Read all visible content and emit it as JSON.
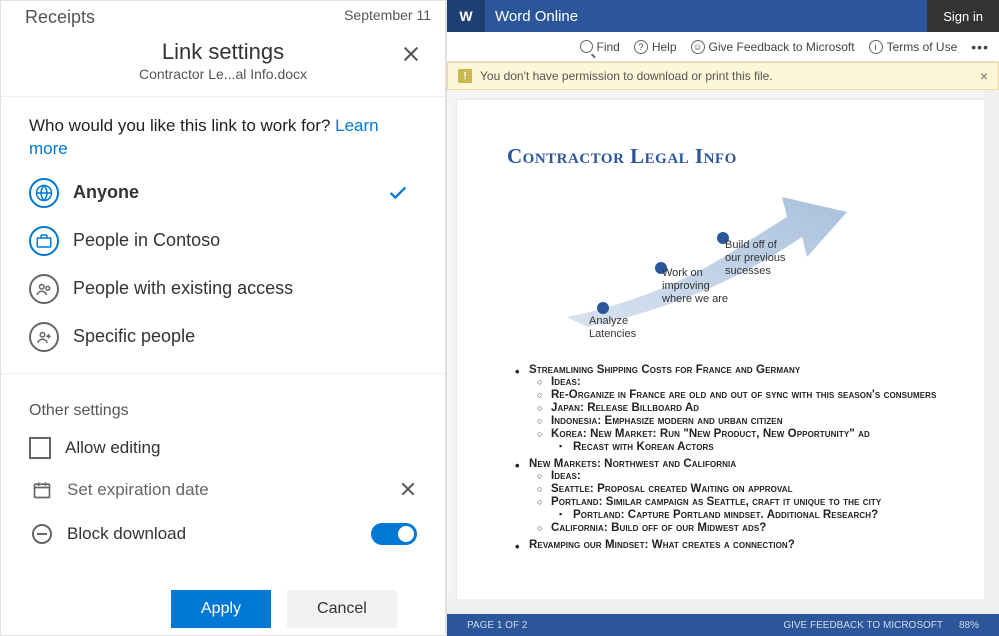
{
  "bg": {
    "text": "Receipts",
    "date": "September 11"
  },
  "dialog": {
    "title": "Link settings",
    "filename": "Contractor Le...al Info.docx",
    "prompt": "Who would you like this link to work for? ",
    "learn_more": "Learn more",
    "options": [
      {
        "label": "Anyone",
        "selected": true
      },
      {
        "label": "People in Contoso",
        "selected": false
      },
      {
        "label": "People with existing access",
        "selected": false
      },
      {
        "label": "Specific people",
        "selected": false
      }
    ],
    "other_title": "Other settings",
    "allow_editing": "Allow editing",
    "expiration": "Set expiration date",
    "block_download": "Block download",
    "apply": "Apply",
    "cancel": "Cancel"
  },
  "word": {
    "app_name": "Word Online",
    "logo_letter": "W",
    "signin": "Sign in",
    "find": "Find",
    "help": "Help",
    "feedback": "Give Feedback to Microsoft",
    "terms": "Terms of Use",
    "notice": "You don't have permission to download or print this file.",
    "doc_title": "Contractor Legal Info",
    "nodes": {
      "n1": "Analyze Latencies",
      "n2": "Work on improving where we are",
      "n3": "Build off of our previous sucesses"
    },
    "bullets": {
      "b1": "Streamlining Shipping Costs for France and Germany",
      "b1_1": "Ideas:",
      "b1_2": "Re-Organize in France are old and out of sync with this season's consumers",
      "b1_3": "Japan: Release  Billboard Ad",
      "b1_4": "Indonesia: Emphasize modern and urban citizen",
      "b1_5": "Korea: New Market:  Run \"New Product, New Opportunity\" ad",
      "b1_5_1": "Recast with Korean Actors",
      "b2": "New Markets: Northwest and California",
      "b2_1": "Ideas:",
      "b2_2": "Seattle: Proposal created Waiting on approval",
      "b2_3": "Portland: Similar campaign as Seattle, craft it unique to the city",
      "b2_3_1": "Portland: Capture Portland mindset.  Additional Research?",
      "b2_4": "California:  Build off of our Midwest ads?",
      "b3": "Revamping our Mindset:  What creates a connection?"
    },
    "status_page": "PAGE 1 OF 2",
    "status_feedback": "GIVE FEEDBACK TO MICROSOFT",
    "status_zoom": "88%"
  }
}
